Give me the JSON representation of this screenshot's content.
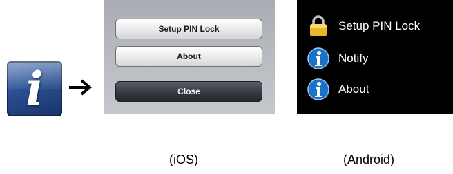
{
  "ios": {
    "buttons": [
      "Setup PIN Lock",
      "About",
      "Close"
    ],
    "caption": "(iOS)"
  },
  "android": {
    "items": [
      {
        "label": "Setup PIN Lock",
        "icon": "padlock-icon"
      },
      {
        "label": "Notify",
        "icon": "info-icon"
      },
      {
        "label": "About",
        "icon": "info-icon"
      }
    ],
    "caption": "(Android)"
  },
  "colors": {
    "info_blue": "#1a73c7",
    "padlock_gold": "#e9b82a"
  }
}
